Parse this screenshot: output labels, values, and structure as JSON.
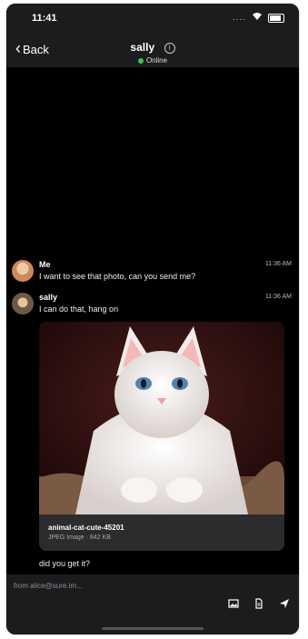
{
  "status_bar": {
    "time": "11:41",
    "signal": "....",
    "wifi": "wifi-icon",
    "battery": "battery-icon"
  },
  "navbar": {
    "back_label": "Back",
    "title": "sally",
    "status": "Online"
  },
  "messages": [
    {
      "sender": "Me",
      "time": "11:36 AM",
      "text": "I want to see that photo, can you send me?"
    },
    {
      "sender": "sally",
      "time": "11:36 AM",
      "text": "I can do that, hang on"
    }
  ],
  "attachment": {
    "file_name": "animal-cat-cute-45201",
    "file_info": "JPEG Image · 842 KB"
  },
  "after_message": "did you get it?",
  "composer": {
    "placeholder": "from alice@sure.im..."
  },
  "colors": {
    "background": "#000000",
    "bar": "#1c1c1e",
    "online": "#34c759"
  }
}
